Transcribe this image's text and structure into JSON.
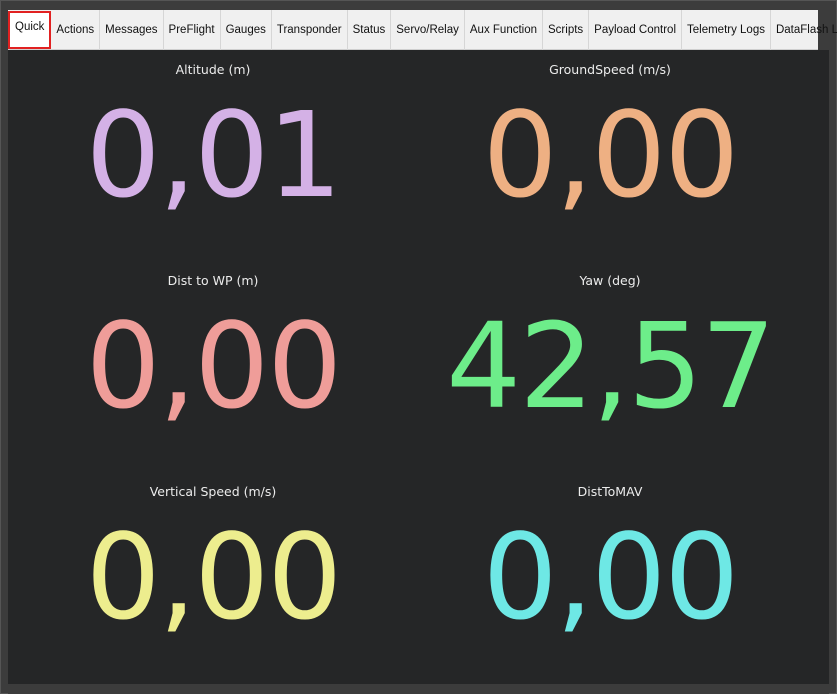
{
  "tabs": [
    {
      "label": "Quick",
      "active": true
    },
    {
      "label": "Actions",
      "active": false
    },
    {
      "label": "Messages",
      "active": false
    },
    {
      "label": "PreFlight",
      "active": false
    },
    {
      "label": "Gauges",
      "active": false
    },
    {
      "label": "Transponder",
      "active": false
    },
    {
      "label": "Status",
      "active": false
    },
    {
      "label": "Servo/Relay",
      "active": false
    },
    {
      "label": "Aux Function",
      "active": false
    },
    {
      "label": "Scripts",
      "active": false
    },
    {
      "label": "Payload Control",
      "active": false
    },
    {
      "label": "Telemetry Logs",
      "active": false
    },
    {
      "label": "DataFlash Logs",
      "active": false
    }
  ],
  "quick": {
    "items": [
      {
        "label": "Altitude (m)",
        "value": "0,01",
        "color": "#d4b1e6"
      },
      {
        "label": "GroundSpeed (m/s)",
        "value": "0,00",
        "color": "#eeb083"
      },
      {
        "label": "Dist to WP (m)",
        "value": "0,00",
        "color": "#ef9d99"
      },
      {
        "label": "Yaw (deg)",
        "value": "42,57",
        "color": "#6ded8a"
      },
      {
        "label": "Vertical Speed (m/s)",
        "value": "0,00",
        "color": "#eded8e"
      },
      {
        "label": "DistToMAV",
        "value": "0,00",
        "color": "#6ee8e5"
      }
    ]
  }
}
